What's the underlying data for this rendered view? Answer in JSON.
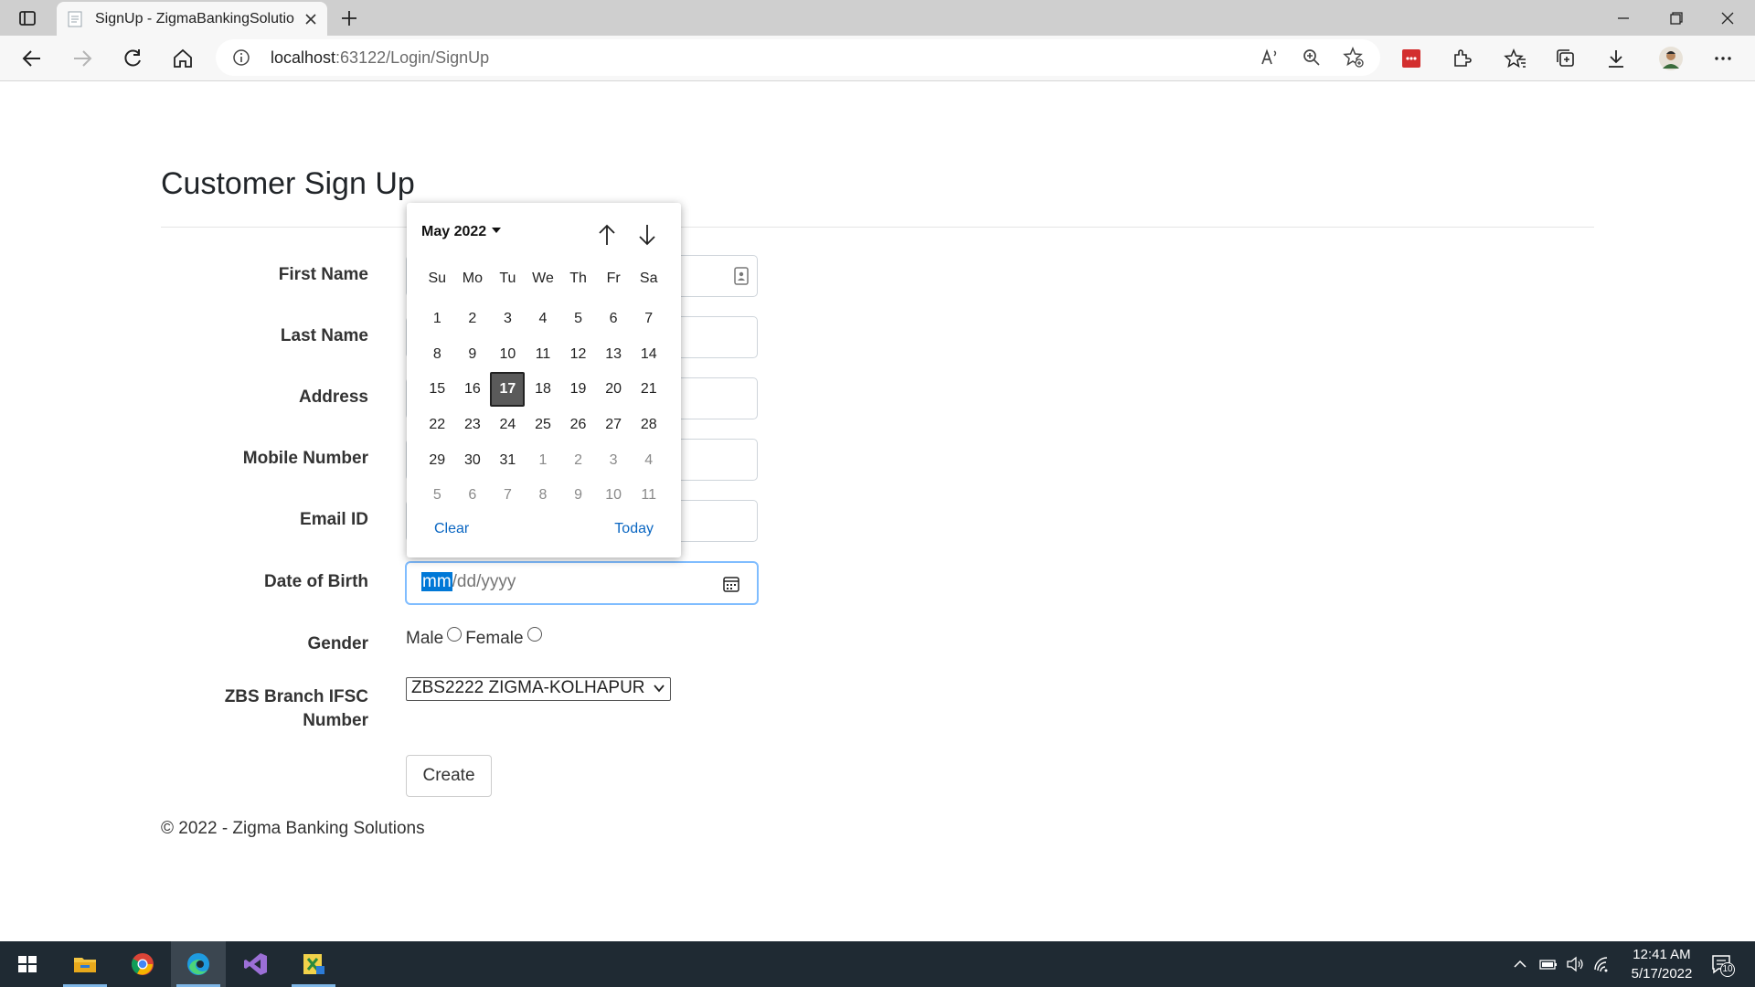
{
  "browser": {
    "tab_title": "SignUp - ZigmaBankingSolutions",
    "address_host": "localhost",
    "address_path": ":63122/Login/SignUp"
  },
  "page": {
    "title": "Customer Sign Up",
    "labels": {
      "first_name": "First Name",
      "last_name": "Last Name",
      "address": "Address",
      "mobile": "Mobile Number",
      "email": "Email ID",
      "dob": "Date of Birth",
      "gender": "Gender",
      "branch_line1": "ZBS Branch IFSC",
      "branch_line2": "Number"
    },
    "dob": {
      "placeholder_month": "mm",
      "placeholder_rest": "/dd/yyyy"
    },
    "gender_options": {
      "male": "Male",
      "female": "Female"
    },
    "branch_selected": "ZBS2222 ZIGMA-KOLHAPUR",
    "create_label": "Create",
    "footer": "© 2022 - Zigma Banking Solutions"
  },
  "datepicker": {
    "month_label": "May 2022",
    "weekdays": [
      "Su",
      "Mo",
      "Tu",
      "We",
      "Th",
      "Fr",
      "Sa"
    ],
    "days": [
      {
        "d": "1",
        "other": false
      },
      {
        "d": "2",
        "other": false
      },
      {
        "d": "3",
        "other": false
      },
      {
        "d": "4",
        "other": false
      },
      {
        "d": "5",
        "other": false
      },
      {
        "d": "6",
        "other": false
      },
      {
        "d": "7",
        "other": false
      },
      {
        "d": "8",
        "other": false
      },
      {
        "d": "9",
        "other": false
      },
      {
        "d": "10",
        "other": false
      },
      {
        "d": "11",
        "other": false
      },
      {
        "d": "12",
        "other": false
      },
      {
        "d": "13",
        "other": false
      },
      {
        "d": "14",
        "other": false
      },
      {
        "d": "15",
        "other": false
      },
      {
        "d": "16",
        "other": false
      },
      {
        "d": "17",
        "other": false,
        "selected": true
      },
      {
        "d": "18",
        "other": false
      },
      {
        "d": "19",
        "other": false
      },
      {
        "d": "20",
        "other": false
      },
      {
        "d": "21",
        "other": false
      },
      {
        "d": "22",
        "other": false
      },
      {
        "d": "23",
        "other": false
      },
      {
        "d": "24",
        "other": false
      },
      {
        "d": "25",
        "other": false
      },
      {
        "d": "26",
        "other": false
      },
      {
        "d": "27",
        "other": false
      },
      {
        "d": "28",
        "other": false
      },
      {
        "d": "29",
        "other": false
      },
      {
        "d": "30",
        "other": false
      },
      {
        "d": "31",
        "other": false
      },
      {
        "d": "1",
        "other": true
      },
      {
        "d": "2",
        "other": true
      },
      {
        "d": "3",
        "other": true
      },
      {
        "d": "4",
        "other": true
      },
      {
        "d": "5",
        "other": true
      },
      {
        "d": "6",
        "other": true
      },
      {
        "d": "7",
        "other": true
      },
      {
        "d": "8",
        "other": true
      },
      {
        "d": "9",
        "other": true
      },
      {
        "d": "10",
        "other": true
      },
      {
        "d": "11",
        "other": true
      }
    ],
    "clear_label": "Clear",
    "today_label": "Today"
  },
  "taskbar": {
    "apps": [
      "windows-start-icon",
      "file-explorer-icon",
      "chrome-icon",
      "edge-icon",
      "visual-studio-icon",
      "app-icon"
    ],
    "time": "12:41 AM",
    "date": "5/17/2022",
    "notification_count": "10"
  },
  "colors": {
    "accent": "#0078d7",
    "link": "#0a66c2",
    "taskbar": "#1f2a33"
  }
}
